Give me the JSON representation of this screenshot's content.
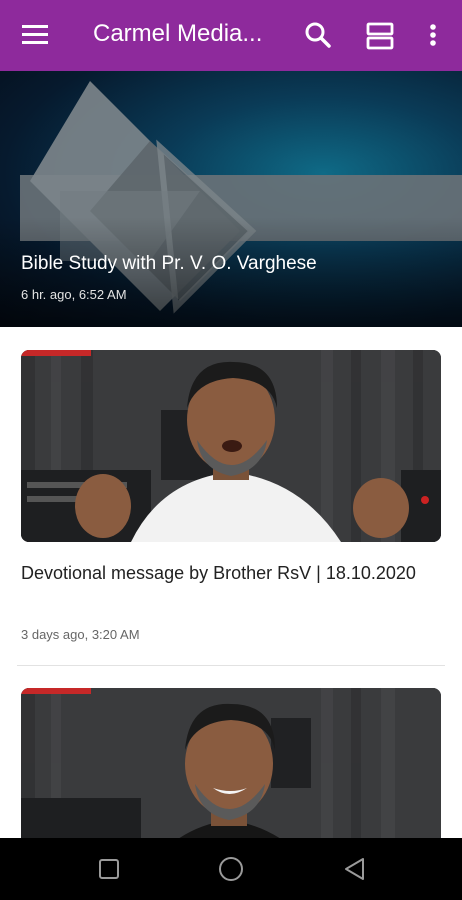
{
  "app_bar": {
    "title": "Carmel Media...",
    "background": "#8e2a9c",
    "icons": [
      "menu-icon",
      "search-icon",
      "view-layout-icon",
      "more-vert-icon"
    ]
  },
  "hero": {
    "title": "Bible Study with Pr. V. O. Varghese",
    "time": "6 hr. ago, 6:52 AM"
  },
  "feed": [
    {
      "title": "Devotional message by Brother RsV | 18.10.2020",
      "time": "3 days ago, 3:20 AM"
    }
  ],
  "nav_bar": {
    "icons": [
      "recents-icon",
      "home-icon",
      "back-icon"
    ]
  }
}
